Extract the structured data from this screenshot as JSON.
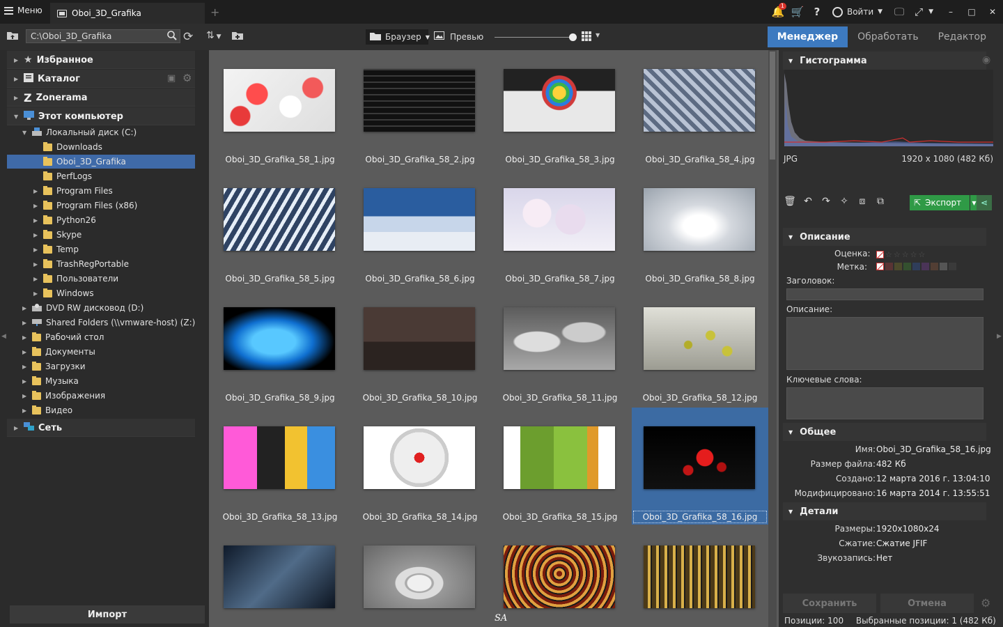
{
  "titlebar": {
    "menu_label": "Меню",
    "tab_title": "Oboi_3D_Grafika",
    "add_tab": "+",
    "notification_count": "1",
    "login_label": "Войти",
    "window_controls": [
      "–",
      "□",
      "✕"
    ]
  },
  "toolbar": {
    "path": "C:\\Oboi_3D_Grafika",
    "view_mode": "Браузер",
    "preview_label": "Превью",
    "zoom_level": 1.0
  },
  "modes": {
    "manager": "Менеджер",
    "process": "Обработать",
    "editor": "Редактор"
  },
  "tree": {
    "favorites": "Избранное",
    "catalog": "Каталог",
    "zonerama": "Zonerama",
    "this_pc": "Этот компьютер",
    "local_disk": "Локальный диск (C:)",
    "folders": [
      "Downloads",
      "Oboi_3D_Grafika",
      "PerfLogs",
      "Program Files",
      "Program Files (x86)",
      "Python26",
      "Skype",
      "Temp",
      "TrashRegPortable",
      "Пользователи",
      "Windows"
    ],
    "drives": [
      "DVD RW дисковод (D:)",
      "Shared Folders (\\\\vmware-host) (Z:)",
      "Рабочий стол",
      "Документы",
      "Загрузки",
      "Музыка",
      "Изображения",
      "Видео"
    ],
    "network": "Сеть",
    "import_label": "Импорт"
  },
  "thumbnails": [
    "Oboi_3D_Grafika_58_1.jpg",
    "Oboi_3D_Grafika_58_2.jpg",
    "Oboi_3D_Grafika_58_3.jpg",
    "Oboi_3D_Grafika_58_4.jpg",
    "Oboi_3D_Grafika_58_5.jpg",
    "Oboi_3D_Grafika_58_6.jpg",
    "Oboi_3D_Grafika_58_7.jpg",
    "Oboi_3D_Grafika_58_8.jpg",
    "Oboi_3D_Grafika_58_9.jpg",
    "Oboi_3D_Grafika_58_10.jpg",
    "Oboi_3D_Grafika_58_11.jpg",
    "Oboi_3D_Grafika_58_12.jpg",
    "Oboi_3D_Grafika_58_13.jpg",
    "Oboi_3D_Grafika_58_14.jpg",
    "Oboi_3D_Grafika_58_15.jpg",
    "Oboi_3D_Grafika_58_16.jpg",
    "",
    "",
    "",
    ""
  ],
  "selected_index": 15,
  "watermark": "SA",
  "right": {
    "histogram_title": "Гистограмма",
    "format": "JPG",
    "dimensions": "1920 x 1080 (482 Кб)",
    "export_label": "Экспорт",
    "description_title": "Описание",
    "rating_label": "Оценка:",
    "label_label": "Метка:",
    "heading_label": "Заголовок:",
    "desc_label": "Описание:",
    "keywords_label": "Ключевые слова:",
    "general_title": "Общее",
    "general": [
      {
        "k": "Имя:",
        "v": "Oboi_3D_Grafika_58_16.jpg"
      },
      {
        "k": "Размер файла:",
        "v": "482 Кб"
      },
      {
        "k": "Создано:",
        "v": "12 марта 2016 г. 13:04:10"
      },
      {
        "k": "Модифицировано:",
        "v": "16 марта 2014 г. 13:55:51"
      }
    ],
    "details_title": "Детали",
    "details": [
      {
        "k": "Размеры:",
        "v": "1920x1080x24"
      },
      {
        "k": "Сжатие:",
        "v": "Сжатие JFIF"
      },
      {
        "k": "Звукозапись:",
        "v": "Нет"
      }
    ],
    "save_label": "Сохранить",
    "cancel_label": "Отмена",
    "status_positions": "Позиции: 100",
    "status_selected": "Выбранные позиции: 1 (482 Кб)"
  },
  "colors": {
    "accent": "#3d7ac0",
    "selection": "#3c6ba3",
    "export_green": "#2f9a46"
  }
}
